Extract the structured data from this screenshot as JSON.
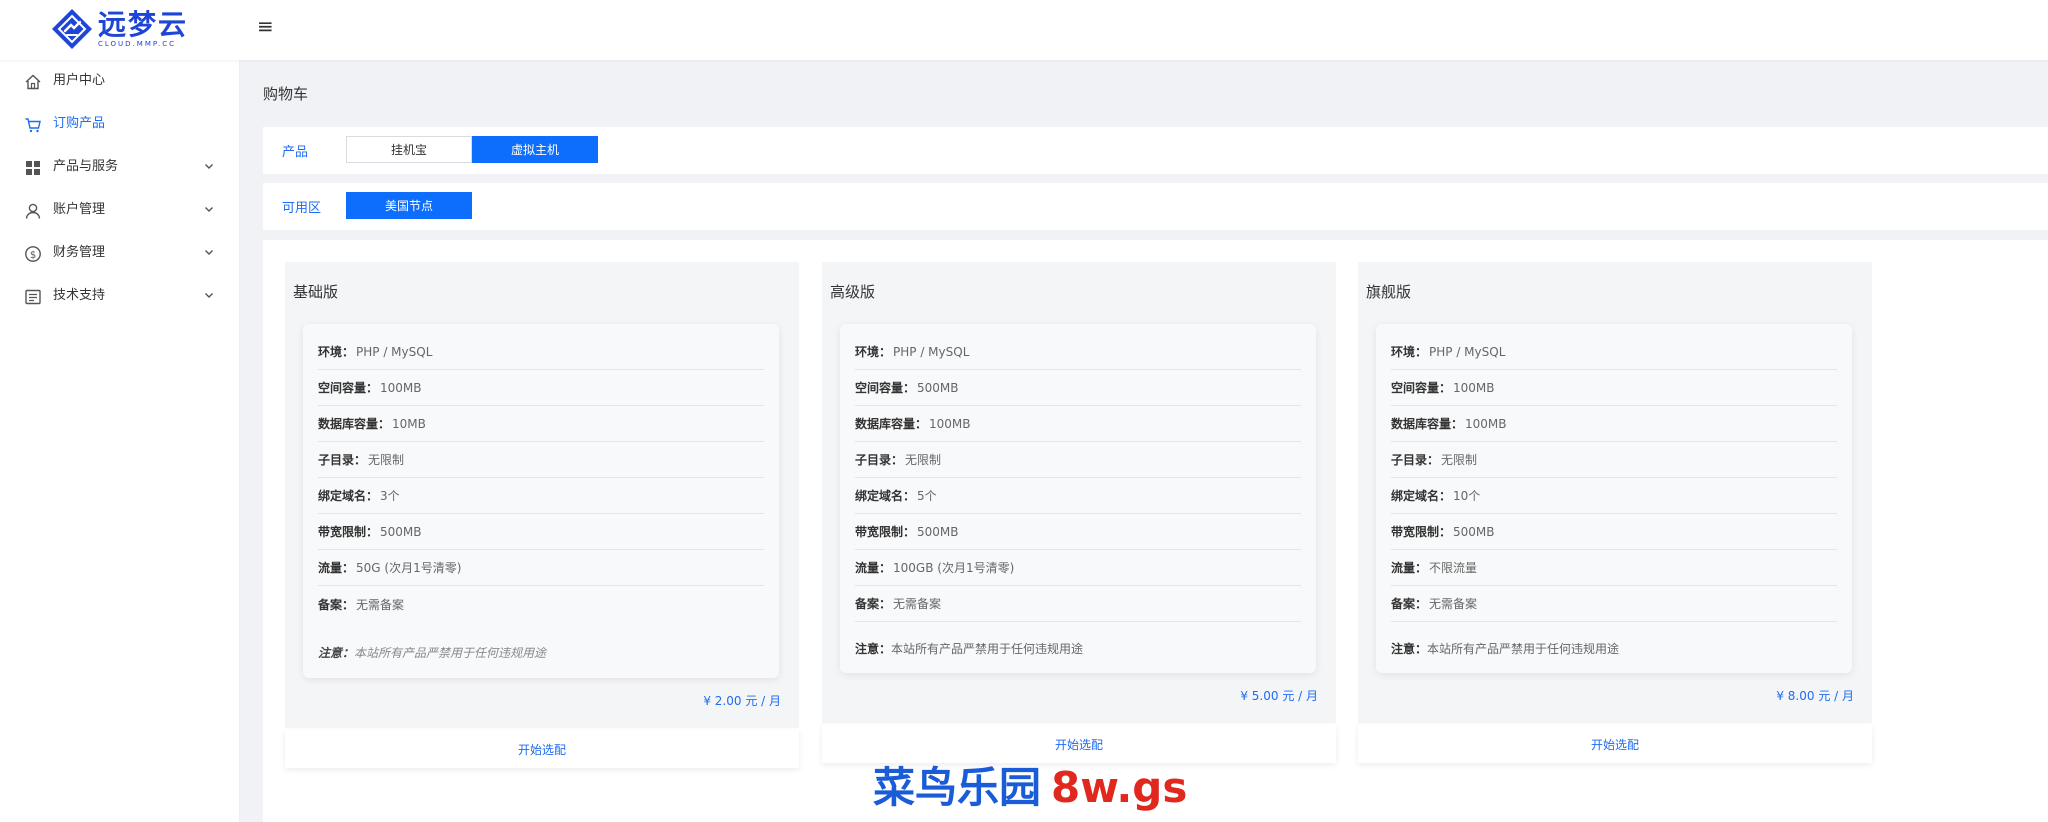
{
  "header": {
    "logo_name": "远梦云",
    "logo_sub": "CLOUD.MMP.CC",
    "menu_toggle": "≡",
    "brand_color": "#1e44d8"
  },
  "sidebar": {
    "items": [
      {
        "label": "用户中心",
        "icon": "home-icon",
        "active": false,
        "has_chevron": false
      },
      {
        "label": "订购产品",
        "icon": "cart-icon",
        "active": true,
        "has_chevron": false
      },
      {
        "label": "产品与服务",
        "icon": "grid-icon",
        "active": false,
        "has_chevron": true
      },
      {
        "label": "账户管理",
        "icon": "user-icon",
        "active": false,
        "has_chevron": true
      },
      {
        "label": "财务管理",
        "icon": "dollar-icon",
        "active": false,
        "has_chevron": true
      },
      {
        "label": "技术支持",
        "icon": "document-icon",
        "active": false,
        "has_chevron": true
      }
    ]
  },
  "page": {
    "title": "购物车"
  },
  "filters": {
    "product": {
      "label": "产品",
      "options": [
        {
          "label": "挂机宝",
          "selected": false
        },
        {
          "label": "虚拟主机",
          "selected": true
        }
      ]
    },
    "zone": {
      "label": "可用区",
      "options": [
        {
          "label": "美国节点",
          "selected": true
        }
      ]
    }
  },
  "plans": [
    {
      "name": "基础版",
      "specs": [
        {
          "key": "环境：",
          "value": "PHP / MySQL"
        },
        {
          "key": "空间容量：",
          "value": "100MB"
        },
        {
          "key": "数据库容量：",
          "value": "10MB"
        },
        {
          "key": "子目录：",
          "value": "无限制"
        },
        {
          "key": "绑定域名：",
          "value": "3个"
        },
        {
          "key": "带宽限制：",
          "value": "500MB"
        },
        {
          "key": "流量：",
          "value": "50G (次月1号清零)"
        },
        {
          "key": "备案：",
          "value": "无需备案"
        }
      ],
      "note_key": "注意：",
      "note_value": "本站所有产品严禁用于任何违规用途",
      "price": "¥ 2.00 元 / 月",
      "button": "开始选配"
    },
    {
      "name": "高级版",
      "specs": [
        {
          "key": "环境：",
          "value": "PHP / MySQL"
        },
        {
          "key": "空间容量：",
          "value": "500MB"
        },
        {
          "key": "数据库容量：",
          "value": "100MB"
        },
        {
          "key": "子目录：",
          "value": "无限制"
        },
        {
          "key": "绑定域名：",
          "value": "5个"
        },
        {
          "key": "带宽限制：",
          "value": "500MB"
        },
        {
          "key": "流量：",
          "value": "100GB (次月1号清零)"
        },
        {
          "key": "备案：",
          "value": "无需备案"
        }
      ],
      "note_key": "注意：",
      "note_value": "本站所有产品严禁用于任何违规用途",
      "price": "¥ 5.00 元 / 月",
      "button": "开始选配"
    },
    {
      "name": "旗舰版",
      "specs": [
        {
          "key": "环境：",
          "value": "PHP / MySQL"
        },
        {
          "key": "空间容量：",
          "value": "100MB"
        },
        {
          "key": "数据库容量：",
          "value": "100MB"
        },
        {
          "key": "子目录：",
          "value": "无限制"
        },
        {
          "key": "绑定域名：",
          "value": "10个"
        },
        {
          "key": "带宽限制：",
          "value": "500MB"
        },
        {
          "key": "流量：",
          "value": "不限流量"
        },
        {
          "key": "备案：",
          "value": "无需备案"
        }
      ],
      "note_key": "注意：",
      "note_value": "本站所有产品严禁用于任何违规用途",
      "price": "¥ 8.00 元 / 月",
      "button": "开始选配"
    }
  ],
  "watermark": {
    "cn": "菜鸟乐园",
    "en": "8w.gs"
  },
  "colors": {
    "accent": "#0d6efd",
    "link": "#1e6bf5",
    "background": "#f1f2f6"
  }
}
